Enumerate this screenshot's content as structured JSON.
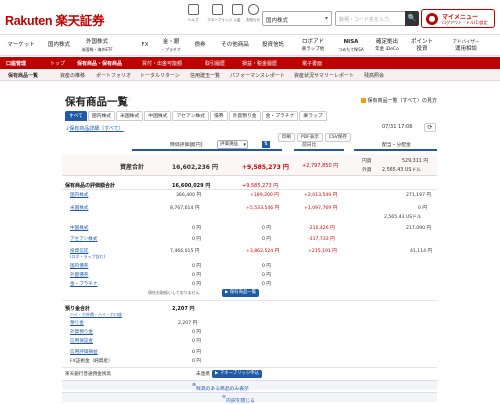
{
  "header": {
    "logo": "Rakuten 楽天証券",
    "icons": [
      {
        "name": "search-icon",
        "label": "ヘルプ"
      },
      {
        "name": "bookmark-icon",
        "label": "マネーブリッジ"
      },
      {
        "name": "inbox-icon",
        "label": "入金"
      },
      {
        "name": "bell-icon",
        "label": "お知らせ"
      }
    ],
    "market_select": "国内株式",
    "search_placeholder": "銘柄・コード名を入力",
    "search_button": "🔍",
    "mymenu_title": "マイメニュー",
    "mymenu_sub": "ログアウト・ドル(1)設定"
  },
  "nav": [
    {
      "l1": "マーケット",
      "l2": ""
    },
    {
      "l1": "国内株式",
      "l2": ""
    },
    {
      "l1": "外国株式",
      "l2": "米国株・海外ETF"
    },
    {
      "l1": "FX",
      "l2": ""
    },
    {
      "l1": "金・銀",
      "l2": "・プラチナ"
    },
    {
      "l1": "債券",
      "l2": ""
    },
    {
      "l1": "その他商品",
      "l2": ""
    },
    {
      "l1": "投資信託",
      "l2": ""
    },
    {
      "l1": "ロボアド",
      "l2": "楽ラップ他"
    },
    {
      "l1": "NISA",
      "l2": "つみたてNISA"
    },
    {
      "l1": "確定拠出",
      "l2": "年金 iDeCo"
    },
    {
      "l1": "ポイント",
      "l2": "投資"
    },
    {
      "l1": "アドバイザー",
      "l2": "運用相談"
    }
  ],
  "sub1": [
    "口座管理",
    "トップ",
    "保有商品・保有商品",
    "買付・出金可能額",
    "取引履歴",
    "損益・税金履歴",
    "電子書面"
  ],
  "sub2": [
    "保有商品一覧",
    "資産の推移",
    "ポートフォリオ",
    "トータルリターン",
    "信用建玉一覧",
    "パフォーマンスレポート",
    "資産状況サマリーレポート",
    "残高照会"
  ],
  "page": {
    "title": "保有商品一覧",
    "guide": "保有商品一覧（すべて）の見方",
    "tabs": [
      "すべて",
      "国内株式",
      "米国株式",
      "中国株式",
      "アセアン株式",
      "債券",
      "外貨預り金",
      "金・プラチナ",
      "楽ラップ"
    ],
    "detail_link": "保有商品詳細（すべて）",
    "tools": [
      "印刷",
      "PDF表示",
      "CSV保存"
    ],
    "date": "07/31 17:08",
    "refresh": "⟳"
  },
  "columns": {
    "valuation": "時価評価額[円]",
    "mode": "評価損益",
    "pl": "評価損益",
    "prev": "前日比",
    "yen": "円換算"
  },
  "totals": {
    "label": "資産合計",
    "value": "16,602,236 円",
    "pl": "+9,585,273 円",
    "day": "+2,797,850 円"
  },
  "fx": [
    {
      "label": "円貨",
      "value": "529,311 円"
    },
    {
      "label": "外貨",
      "value": "2,565.43 USドル"
    }
  ],
  "holdings_header": {
    "label": "保有商品の評価額合計",
    "value": "16,600,029 円",
    "pl": "+9,585,273 円"
  },
  "rows": [
    {
      "label": "国内株式",
      "value": "366,400 円",
      "pl": "+189,200 円",
      "day": "+2,013,549 円",
      "right": "271,197 円"
    },
    {
      "label": "米国株式",
      "value": "8,767,614 円",
      "pl": "+5,533,546 円",
      "day": "+1,097,769 円",
      "right": "0 円"
    },
    {
      "label": "",
      "value": "",
      "pl": "",
      "day": "",
      "right": "2,565.43 USドル"
    },
    {
      "label": "中国株式",
      "value": "0 円",
      "pl": "0 円",
      "day": "-210,426 円",
      "right": "217,090 円"
    },
    {
      "label": "アセアン株式",
      "value": "0 円",
      "pl": "0 円",
      "day": "-317,733 円",
      "right": ""
    },
    {
      "label": "投資信託",
      "value": "7,466,015 円",
      "pl": "+3,862,524 円",
      "day": "+215,191 円",
      "right": "41,114 円"
    },
    {
      "label": "国内債券",
      "value": "0 円",
      "pl": "0 円",
      "day": "",
      "right": ""
    },
    {
      "label": "外国債券",
      "value": "0 円",
      "pl": "0 円",
      "day": "",
      "right": ""
    },
    {
      "label": "金・プラチナ",
      "value": "0 円",
      "pl": "0 円",
      "day": "",
      "right": ""
    }
  ],
  "note": "現在お取扱いしておりません",
  "kinpla_button": "保有商品一覧",
  "deposit": {
    "label": "預り金合計",
    "value": "2,207 円",
    "sub": "ハイ・ホ外債・ハイ・ホ口座",
    "rows": [
      {
        "label": "預り金",
        "value": "2,207 円"
      },
      {
        "label": "外貨預り金",
        "value": "0 円"
      },
      {
        "label": "信用保証金",
        "value": "0 円"
      },
      {
        "label": "信用評価損益",
        "value": "0 円"
      },
      {
        "label": "FX証拠金（純資産）",
        "value": "0 円"
      }
    ]
  },
  "bank": {
    "label": "楽天銀行普通預金残高",
    "status": "未連携",
    "button": "マネーブリッジ申込"
  },
  "footer": {
    "b1": "残高のある商品のみ表示",
    "b2": "内訳を閉じる"
  },
  "right_header": "配当・分配金",
  "mid_header": "前日比"
}
